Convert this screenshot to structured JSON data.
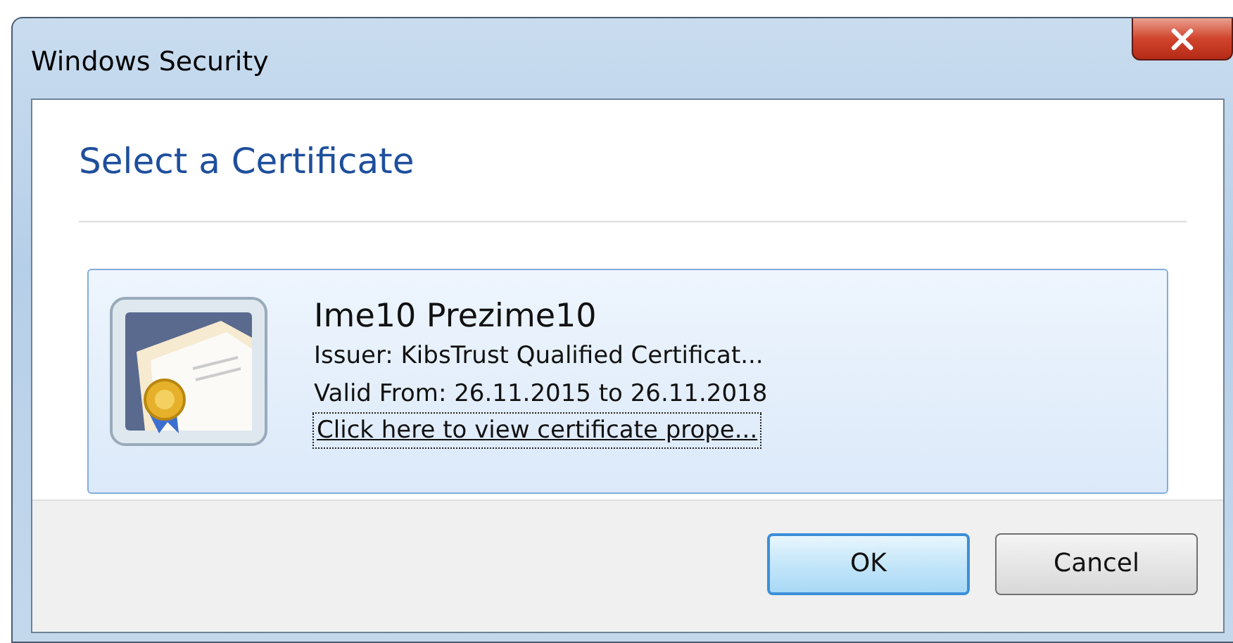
{
  "window": {
    "title": "Windows Security"
  },
  "heading": "Select a Certificate",
  "certificates": [
    {
      "name": "Ime10 Prezime10",
      "issuer": "Issuer: KibsTrust Qualified Certificat...",
      "validity": "Valid From: 26.11.2015 to 26.11.2018",
      "link": "Click here to view certificate prope...",
      "selected": true
    }
  ],
  "buttons": [
    {
      "label": "OK",
      "default": true
    },
    {
      "label": "Cancel",
      "default": false
    }
  ]
}
